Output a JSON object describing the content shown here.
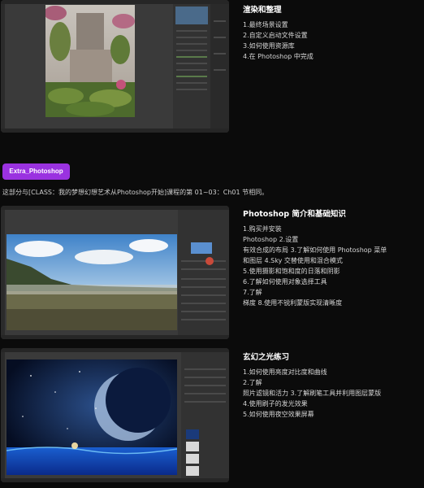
{
  "sections": [
    {
      "title": "渲染和整理",
      "items": [
        "1.最终场景设置",
        "2.自定义启动文件设置",
        "3.如何使用资源库",
        "4.在 Photoshop 中完成"
      ]
    },
    {
      "title": "Photoshop 简介和基础知识",
      "items": [
        "1.购买并安装",
        "Photoshop 2.设置",
        "有效合成的布局 3.了解如何使用 Photoshop 菜单",
        "和图层 4.Sky 交替使用和混合模式",
        "5.使用摄影和饱和度的日落和阴影",
        "6.了解如何使用对象选择工具",
        "7.了解",
        "梯度 8.使用不锐利蒙版实现清晰度"
      ]
    },
    {
      "title": "玄幻之光练习",
      "items": [
        "1.如何使用亮度对比度和曲线",
        "2.了解",
        "照片滤镜和活力 3.了解刷笔工具并利用图层蒙版",
        "4.使用刷子的发光效果",
        "5.如何使用夜空效果屏幕"
      ]
    }
  ],
  "category_badge": "Extra_Photoshop",
  "intro_text": "这部分与[CLASS：我的梦想幻想艺术从Photoshop开始]课程的第 01~03：Ch01 节相同。",
  "colors": {
    "badge": "#9a32e0",
    "background": "#0b0b0b"
  }
}
